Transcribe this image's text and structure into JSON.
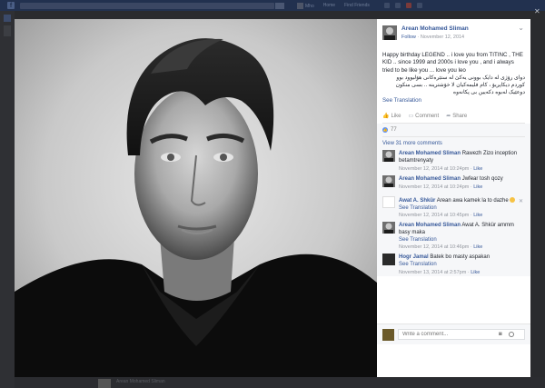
{
  "topbar": {
    "logo_glyph": "f",
    "nav_name": "Mho",
    "nav_home": "Home",
    "nav_find": "Find Friends"
  },
  "post": {
    "author": "Arean Mohamed Sliman",
    "follow": "Follow",
    "date": "November 12, 2014",
    "body_en": "Happy birthday LEGEND .. i love you from TITINC , THE KID .. since 1999 and 2000s i love you , and i always tried to be like you ... love you leo",
    "body_ku": "دوای رۆژی لە دایک بوونی یەکێ لە ستێرەکانی هۆلیوود بوو کوردم دیکاپریۆ ، کام فلیمەکیان لا خۆشترینە .. بسی منکون دوعێیک لەبوە دکەیین بی پکانەوە",
    "see_translation": "See Translation",
    "actions": {
      "like": "Like",
      "comment": "Comment",
      "share": "Share"
    },
    "likes_count": "77"
  },
  "comments": {
    "view_more": "View 31 more comments",
    "items": [
      {
        "author": "Arean Mohamed Sliman",
        "text": "Rawezh Zizo inception betamtrenyaty",
        "translation": "",
        "date": "November 12, 2014 at 10:24pm",
        "like": "Like"
      },
      {
        "author": "Arean Mohamed Sliman",
        "text": "Jwfear tosh qozy",
        "translation": "",
        "date": "November 12, 2014 at 10:24pm",
        "like": "Like"
      },
      {
        "author": "Awat A. Shkür",
        "text": "Arean awa kamek la to dazhe",
        "translation": "See Translation",
        "date": "November 12, 2014 at 10:45pm",
        "like": "Like",
        "emoji": true
      },
      {
        "author": "Arean Mohamed Sliman",
        "text": "Awat A. Shkür ammm basy maka",
        "translation": "See Translation",
        "date": "November 12, 2014 at 10:46pm",
        "like": "Like"
      },
      {
        "author": "Hogr Jamal",
        "text": "Batek bo masty aspakan",
        "translation": "See Translation",
        "date": "November 13, 2014 at 2:57pm",
        "like": "Like"
      }
    ]
  },
  "composer": {
    "placeholder": "Write a comment..."
  },
  "bottom": {
    "text": "Arean Mohamed Sliman"
  },
  "colors": {
    "link": "#365899",
    "topbar": "#22314f",
    "panel": "#ffffff"
  },
  "icons": [
    "facebook-logo-icon",
    "like-icon",
    "comment-icon",
    "share-icon",
    "camera-icon",
    "smiley-icon",
    "close-icon",
    "more-icon"
  ]
}
